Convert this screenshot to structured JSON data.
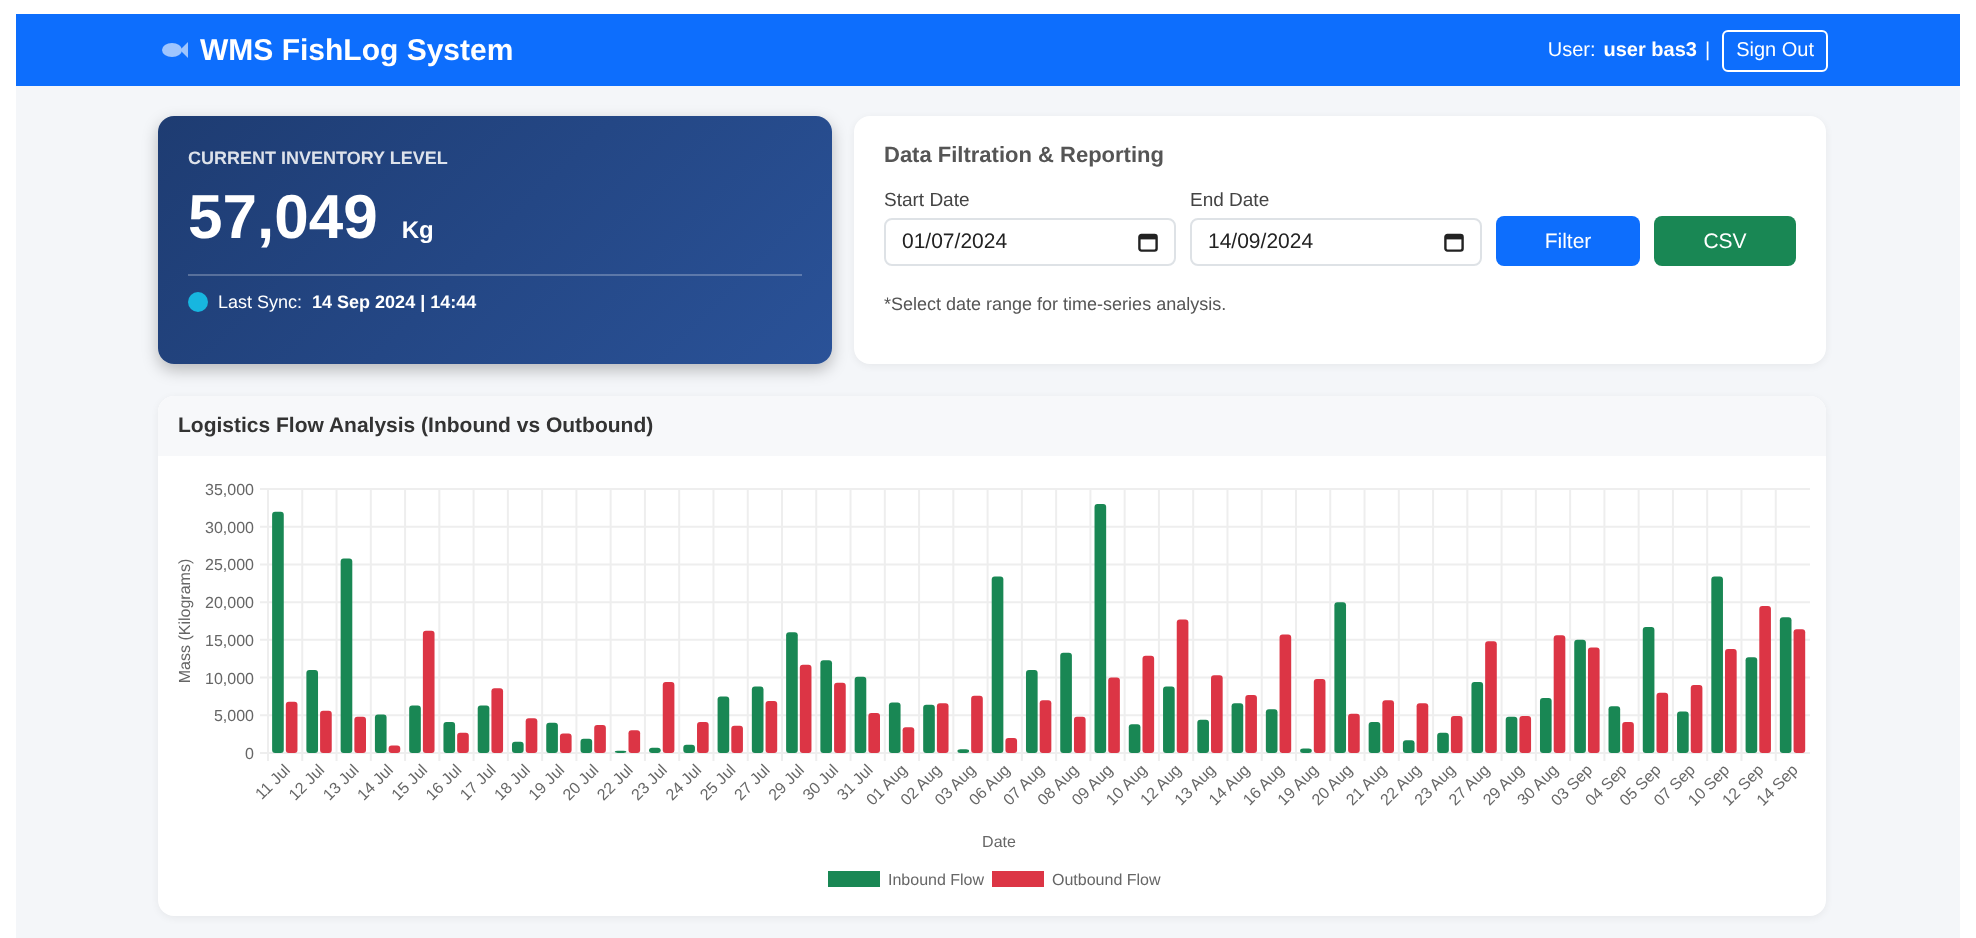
{
  "header": {
    "title": "WMS FishLog System",
    "user_label": "User:",
    "user_name": "user bas3",
    "separator": "|",
    "sign_out": "Sign Out"
  },
  "inventory": {
    "label": "CURRENT INVENTORY LEVEL",
    "value": "57,049",
    "unit": "Kg",
    "sync_label": "Last Sync:",
    "sync_time": "14 Sep 2024 | 14:44"
  },
  "filter": {
    "title": "Data Filtration & Reporting",
    "start_label": "Start Date",
    "start_value": "01/07/2024",
    "end_label": "End Date",
    "end_value": "14/09/2024",
    "filter_button": "Filter",
    "csv_button": "CSV",
    "note": "*Select date range for time-series analysis."
  },
  "chart_panel": {
    "title": "Logistics Flow Analysis (Inbound vs Outbound)",
    "chart_data": {
      "type": "bar",
      "grid": true,
      "legend": true,
      "xlabel": "Date",
      "ylabel": "Mass (Kilograms)",
      "ylim": [
        0,
        35000
      ],
      "yticks": [
        {
          "value": 0,
          "label": "0"
        },
        {
          "value": 5000,
          "label": "5,000"
        },
        {
          "value": 10000,
          "label": "10,000"
        },
        {
          "value": 15000,
          "label": "15,000"
        },
        {
          "value": 20000,
          "label": "20,000"
        },
        {
          "value": 25000,
          "label": "25,000"
        },
        {
          "value": 30000,
          "label": "30,000"
        },
        {
          "value": 35000,
          "label": "35,000"
        }
      ],
      "categories": [
        "11 Jul",
        "12 Jul",
        "13 Jul",
        "14 Jul",
        "15 Jul",
        "16 Jul",
        "17 Jul",
        "18 Jul",
        "19 Jul",
        "20 Jul",
        "22 Jul",
        "23 Jul",
        "24 Jul",
        "25 Jul",
        "27 Jul",
        "29 Jul",
        "30 Jul",
        "31 Jul",
        "01 Aug",
        "02 Aug",
        "03 Aug",
        "06 Aug",
        "07 Aug",
        "08 Aug",
        "09 Aug",
        "10 Aug",
        "12 Aug",
        "13 Aug",
        "14 Aug",
        "16 Aug",
        "19 Aug",
        "20 Aug",
        "21 Aug",
        "22 Aug",
        "23 Aug",
        "27 Aug",
        "29 Aug",
        "30 Aug",
        "03 Sep",
        "04 Sep",
        "05 Sep",
        "07 Sep",
        "10 Sep",
        "12 Sep",
        "14 Sep"
      ],
      "series": [
        {
          "name": "Inbound Flow",
          "color": "#198754",
          "values": [
            32000,
            11000,
            25800,
            5100,
            6300,
            4100,
            6300,
            1500,
            4000,
            1900,
            300,
            700,
            1100,
            7500,
            8800,
            16000,
            12300,
            10100,
            6700,
            6400,
            500,
            23400,
            11000,
            13300,
            33000,
            3800,
            8800,
            4400,
            6600,
            5800,
            600,
            20000,
            4100,
            1700,
            2700,
            9400,
            4800,
            7300,
            15000,
            6200,
            16700,
            5500,
            23400,
            12700,
            18000
          ]
        },
        {
          "name": "Outbound Flow",
          "color": "#dc3545",
          "values": [
            6800,
            5600,
            4800,
            1000,
            16200,
            2700,
            8600,
            4600,
            2600,
            3700,
            3000,
            9400,
            4100,
            3600,
            6900,
            11700,
            9300,
            5300,
            3400,
            6600,
            7600,
            2000,
            7000,
            4800,
            10000,
            12900,
            17700,
            10300,
            7700,
            15700,
            9800,
            5200,
            7000,
            6600,
            4900,
            14800,
            4900,
            15600,
            14000,
            4100,
            8000,
            9000,
            13800,
            19500,
            16400
          ]
        }
      ]
    }
  }
}
